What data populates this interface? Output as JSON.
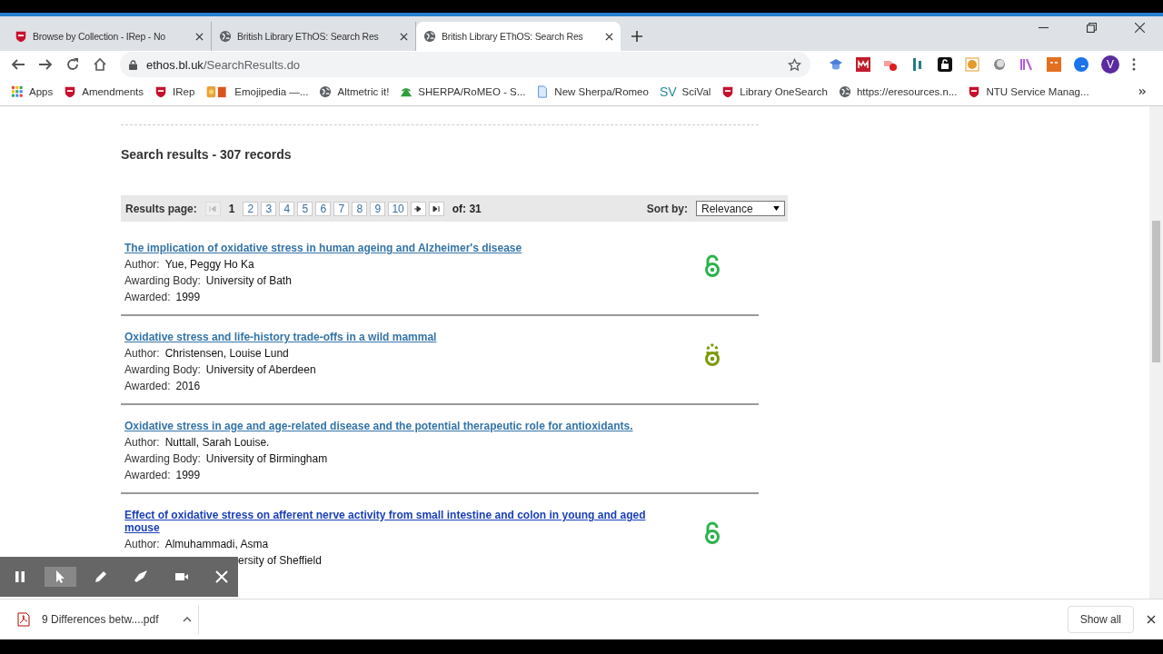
{
  "tabs": [
    {
      "title": "Browse by Collection - IRep - No",
      "kind": "shield",
      "selected": false
    },
    {
      "title": "British Library EThOS: Search Res",
      "kind": "globe",
      "selected": false
    },
    {
      "title": "British Library EThOS: Search Res",
      "kind": "globe",
      "selected": true
    }
  ],
  "address": {
    "host": "ethos.bl.uk",
    "path": "/SearchResults.do"
  },
  "bookmarks": [
    {
      "label": "Apps",
      "kind": "apps"
    },
    {
      "label": "Amendments",
      "kind": "shield"
    },
    {
      "label": "IRep",
      "kind": "shield"
    },
    {
      "label": "Emojipedia —...",
      "kind": "book"
    },
    {
      "label": "Altmetric it!",
      "kind": "globe"
    },
    {
      "label": "SHERPA/RoMEO - S...",
      "kind": "sherpa"
    },
    {
      "label": "New Sherpa/Romeo",
      "kind": "doc"
    },
    {
      "label": "SciVal",
      "kind": "sv",
      "badge": "SV"
    },
    {
      "label": "Library OneSearch",
      "kind": "shield"
    },
    {
      "label": "https://eresources.n...",
      "kind": "globe"
    },
    {
      "label": "NTU Service Manag...",
      "kind": "shield"
    }
  ],
  "profile_initial": "V",
  "results_heading": "Search results - 307 records",
  "pager": {
    "label": "Results page:",
    "pages": [
      {
        "label": "1",
        "selected": true
      },
      {
        "label": "2",
        "selected": false
      },
      {
        "label": "3",
        "selected": false
      },
      {
        "label": "4",
        "selected": false
      },
      {
        "label": "5",
        "selected": false
      },
      {
        "label": "6",
        "selected": false
      },
      {
        "label": "7",
        "selected": false
      },
      {
        "label": "8",
        "selected": false
      },
      {
        "label": "9",
        "selected": false
      },
      {
        "label": "10",
        "selected": false
      }
    ],
    "first_disabled": true,
    "total": "of: 31",
    "sort_label": "Sort by:",
    "sort_value": "Relevance"
  },
  "results": [
    {
      "title": "The implication of oxidative stress in human ageing and Alzheimer's disease",
      "visited": true,
      "kind": "open",
      "fields": [
        {
          "label": "Author:",
          "value": "Yue, Peggy Ho Ka"
        },
        {
          "label": "Awarding Body:",
          "value": "University of Bath"
        },
        {
          "label": "Awarded:",
          "value": "1999"
        }
      ]
    },
    {
      "title": "Oxidative stress and life-history trade-offs in a wild mammal",
      "visited": true,
      "kind": "partial",
      "fields": [
        {
          "label": "Author:",
          "value": "Christensen, Louise Lund"
        },
        {
          "label": "Awarding Body:",
          "value": "University of Aberdeen"
        },
        {
          "label": "Awarded:",
          "value": "2016"
        }
      ]
    },
    {
      "title": "Oxidative stress in age and age-related disease and the potential therapeutic role for antioxidants.",
      "visited": true,
      "kind": "plain",
      "fields": [
        {
          "label": "Author:",
          "value": "Nuttall, Sarah Louise."
        },
        {
          "label": "Awarding Body:",
          "value": "University of Birmingham"
        },
        {
          "label": "Awarded:",
          "value": "1999"
        }
      ]
    },
    {
      "title": "Effect of oxidative stress on afferent nerve activity from small intestine and colon in young and aged mouse",
      "visited": false,
      "kind": "open",
      "fields": [
        {
          "label": "Author:",
          "value": "Almuhammadi, Asma"
        },
        {
          "value": "ersity of Sheffield"
        }
      ]
    }
  ],
  "recorder": {
    "tools": [
      {
        "kind": "pause",
        "selected": false
      },
      {
        "kind": "pointer",
        "selected": true
      },
      {
        "kind": "pen",
        "selected": false
      },
      {
        "kind": "eraser",
        "selected": false
      },
      {
        "kind": "camera",
        "selected": false
      },
      {
        "kind": "close",
        "selected": false
      }
    ]
  },
  "download": {
    "file": "9 Differences betw....pdf",
    "button": "Show all"
  }
}
